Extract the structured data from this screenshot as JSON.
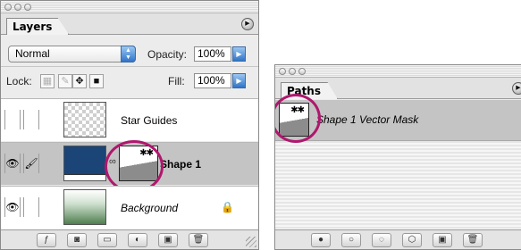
{
  "layers_panel": {
    "tab_label": "Layers",
    "menu_icon": "triangle-right-icon",
    "blend_mode": "Normal",
    "opacity_label": "Opacity:",
    "opacity_value": "100%",
    "lock_label": "Lock:",
    "fill_label": "Fill:",
    "fill_value": "100%",
    "layers": [
      {
        "name": "Star Guides",
        "visible": false,
        "selected": false
      },
      {
        "name": "Shape 1",
        "visible": true,
        "selected": true
      },
      {
        "name": "Background",
        "visible": true,
        "selected": false,
        "locked": true
      }
    ],
    "footer_icons": [
      "layer-style-icon",
      "add-mask-icon",
      "new-group-icon",
      "adjustment-layer-icon",
      "new-layer-icon",
      "trash-icon"
    ]
  },
  "paths_panel": {
    "tab_label": "Paths",
    "menu_icon": "triangle-right-icon",
    "paths": [
      {
        "name": "Shape 1 Vector Mask",
        "selected": true
      }
    ],
    "footer_icons": [
      "fill-path-icon",
      "stroke-path-icon",
      "load-selection-icon",
      "make-work-path-icon",
      "new-path-icon",
      "trash-icon"
    ]
  },
  "colors": {
    "highlight_ring": "#b0176e",
    "shape_fill": "#1a4576",
    "selected_row": "#c4c4c4",
    "accent_blue": "#2f74c8"
  }
}
